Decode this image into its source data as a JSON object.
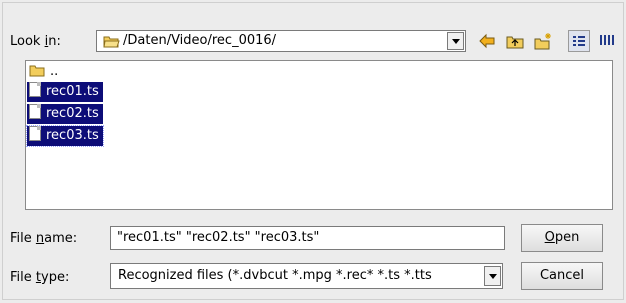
{
  "look_in": {
    "label_pre": "Look ",
    "label_mnemonic": "i",
    "label_post": "n:",
    "path": "/Daten/Video/rec_0016/"
  },
  "toolbar": {
    "icons": [
      "back-arrow-icon",
      "parent-folder-icon",
      "new-folder-icon",
      "detail-view-icon",
      "list-view-icon"
    ],
    "accent": "#e8a400"
  },
  "file_list": {
    "parent": "..",
    "items": [
      "rec01.ts",
      "rec02.ts",
      "rec03.ts"
    ],
    "selection_color": "#0d0d78"
  },
  "file_name": {
    "label_pre": "File ",
    "label_mnemonic": "n",
    "label_post": "ame:",
    "value": "\"rec01.ts\" \"rec02.ts\" \"rec03.ts\""
  },
  "file_type": {
    "label_pre": "File ",
    "label_mnemonic": "t",
    "label_post": "ype:",
    "value": "Recognized files (*.dvbcut *.mpg *.rec* *.ts *.tts"
  },
  "buttons": {
    "open_mnemonic": "O",
    "open_rest": "pen",
    "cancel": "Cancel"
  }
}
